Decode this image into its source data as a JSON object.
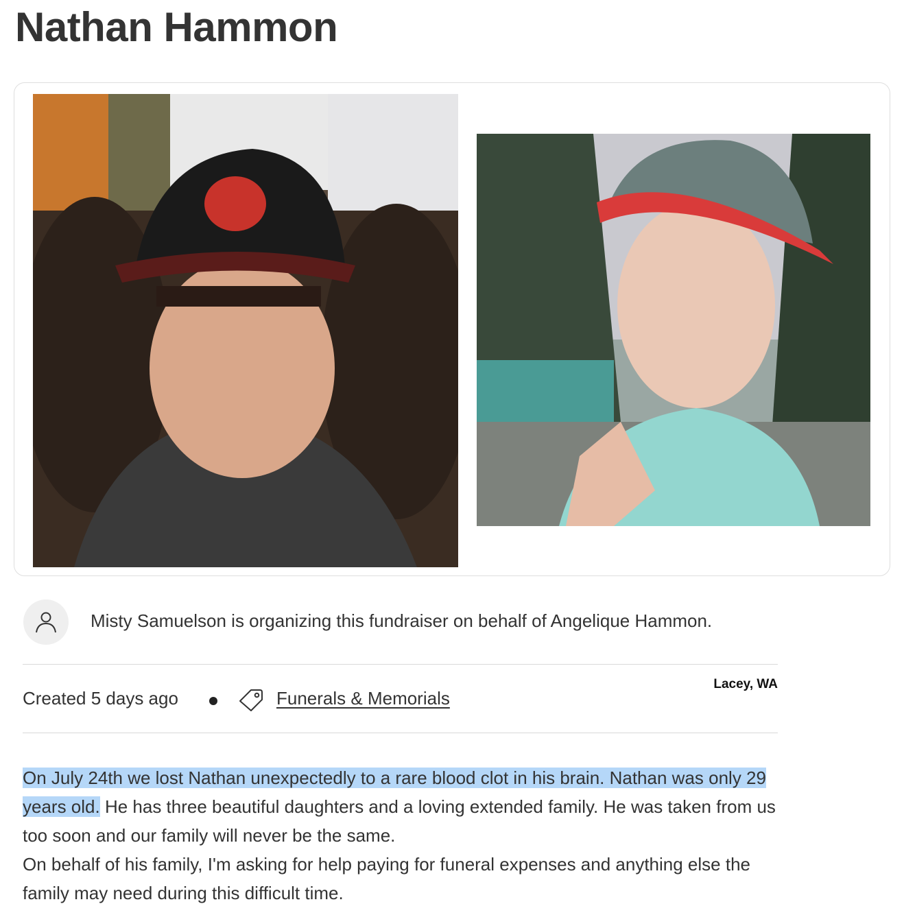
{
  "campaign": {
    "title": "Nathan Hammon"
  },
  "organizer": {
    "text": "Misty Samuelson is organizing this fundraiser on behalf of Angelique Hammon."
  },
  "meta": {
    "created": "Created 5 days ago",
    "category": "Funerals & Memorials",
    "location": "Lacey, WA"
  },
  "story": {
    "highlighted": "On July 24th we lost Nathan unexpectedly to a rare blood clot in his brain. Nathan was only 29 years old.",
    "rest": " He has three beautiful daughters and a loving extended family. He was taken from us too soon and our family will never be the same.",
    "paragraph2": "On behalf of his family, I'm asking for help paying for funeral expenses and anything else the family may need during this difficult time."
  },
  "colors": {
    "text": "#333333",
    "highlight": "#b5d7f8",
    "divider": "#d9d9d9",
    "avatar_bg": "#efefef"
  },
  "icons": [
    "user-icon",
    "tag-icon"
  ]
}
